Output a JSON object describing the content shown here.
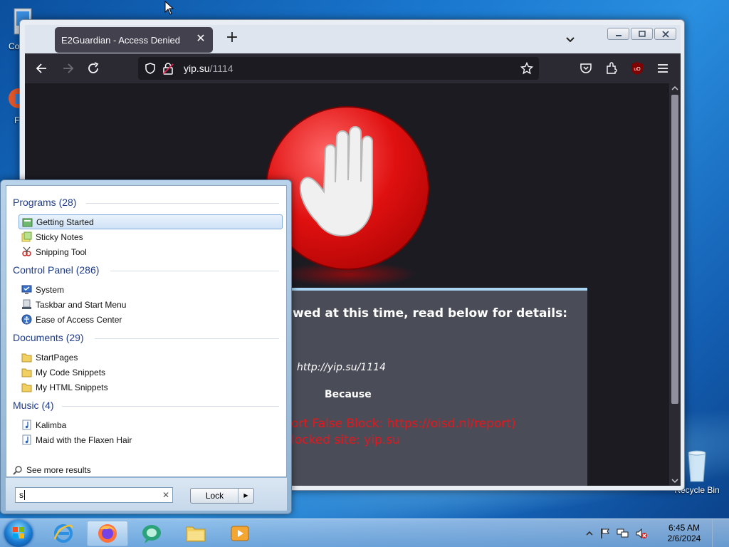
{
  "desktop": {
    "icons": [
      {
        "label": "Co"
      },
      {
        "label": "F"
      },
      {
        "label": "Recycle Bin"
      }
    ]
  },
  "browser": {
    "tab_title": "E2Guardian - Access Denied",
    "url_host": "yip.su",
    "url_path": "/1114",
    "deny_page": {
      "headline": "wed at this time, read below for details:",
      "url_line": "http://yip.su/1114",
      "because": "Because",
      "red_line_1": "ort False Block: https://oisd.nl/report)",
      "red_line_2": "locked site: yip.su"
    }
  },
  "start_menu": {
    "sections": [
      {
        "title": "Programs (28)",
        "items": [
          {
            "label": "Getting Started",
            "icon": "getting-started-icon"
          },
          {
            "label": "Sticky Notes",
            "icon": "sticky-notes-icon"
          },
          {
            "label": "Snipping Tool",
            "icon": "snipping-tool-icon"
          }
        ]
      },
      {
        "title": "Control Panel (286)",
        "items": [
          {
            "label": "System",
            "icon": "system-icon"
          },
          {
            "label": "Taskbar and Start Menu",
            "icon": "taskbar-icon"
          },
          {
            "label": "Ease of Access Center",
            "icon": "ease-of-access-icon"
          }
        ]
      },
      {
        "title": "Documents (29)",
        "items": [
          {
            "label": "StartPages",
            "icon": "folder-icon"
          },
          {
            "label": "My Code Snippets",
            "icon": "folder-icon"
          },
          {
            "label": "My HTML Snippets",
            "icon": "folder-icon"
          }
        ]
      },
      {
        "title": "Music (4)",
        "items": [
          {
            "label": "Kalimba",
            "icon": "music-file-icon"
          },
          {
            "label": "Maid with the Flaxen Hair",
            "icon": "music-file-icon"
          }
        ]
      }
    ],
    "see_more": "See more results",
    "search_value": "s",
    "lock_label": "Lock"
  },
  "taskbar": {
    "time": "6:45 AM",
    "date": "2/6/2024"
  },
  "colors": {
    "deny_red": "#e8151b",
    "browser_dark": "#1c1b22",
    "start_heading": "#1e3b8a"
  }
}
